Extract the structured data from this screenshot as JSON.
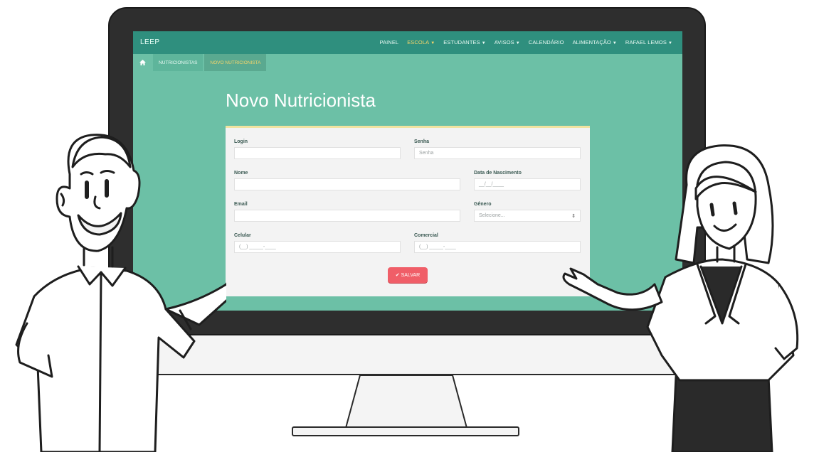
{
  "app": {
    "brand": "LEEP",
    "nav": [
      {
        "label": "PAINEL",
        "dropdown": false,
        "active": false
      },
      {
        "label": "ESCOLA",
        "dropdown": true,
        "active": true
      },
      {
        "label": "ESTUDANTES",
        "dropdown": true,
        "active": false
      },
      {
        "label": "AVISOS",
        "dropdown": true,
        "active": false
      },
      {
        "label": "CALENDÁRIO",
        "dropdown": false,
        "active": false
      },
      {
        "label": "ALIMENTAÇÃO",
        "dropdown": true,
        "active": false
      },
      {
        "label": "RAFAEL LEMOS",
        "dropdown": true,
        "active": false
      }
    ],
    "breadcrumb": {
      "home_icon": "home-icon",
      "items": [
        "NUTRICIONISTAS",
        "NOVO NUTRICIONISTA"
      ]
    }
  },
  "page": {
    "title": "Novo Nutricionista"
  },
  "form": {
    "login": {
      "label": "Login",
      "value": ""
    },
    "senha": {
      "label": "Senha",
      "placeholder": "Senha"
    },
    "nome": {
      "label": "Nome",
      "value": ""
    },
    "data_nascimento": {
      "label": "Data de Nascimento",
      "placeholder": "__/__/____"
    },
    "email": {
      "label": "Email",
      "value": ""
    },
    "genero": {
      "label": "Gênero",
      "selected": "Selecione..."
    },
    "celular": {
      "label": "Celular",
      "placeholder": "(__) _____-____"
    },
    "comercial": {
      "label": "Comercial",
      "placeholder": "(__) _____-____"
    },
    "save_label": "SALVAR",
    "save_icon": "check-icon"
  },
  "colors": {
    "screen_bg": "#6cc0a6",
    "navbar_bg": "#2f8f7e",
    "active_nav": "#f7d56a",
    "save_button": "#f05e68"
  }
}
